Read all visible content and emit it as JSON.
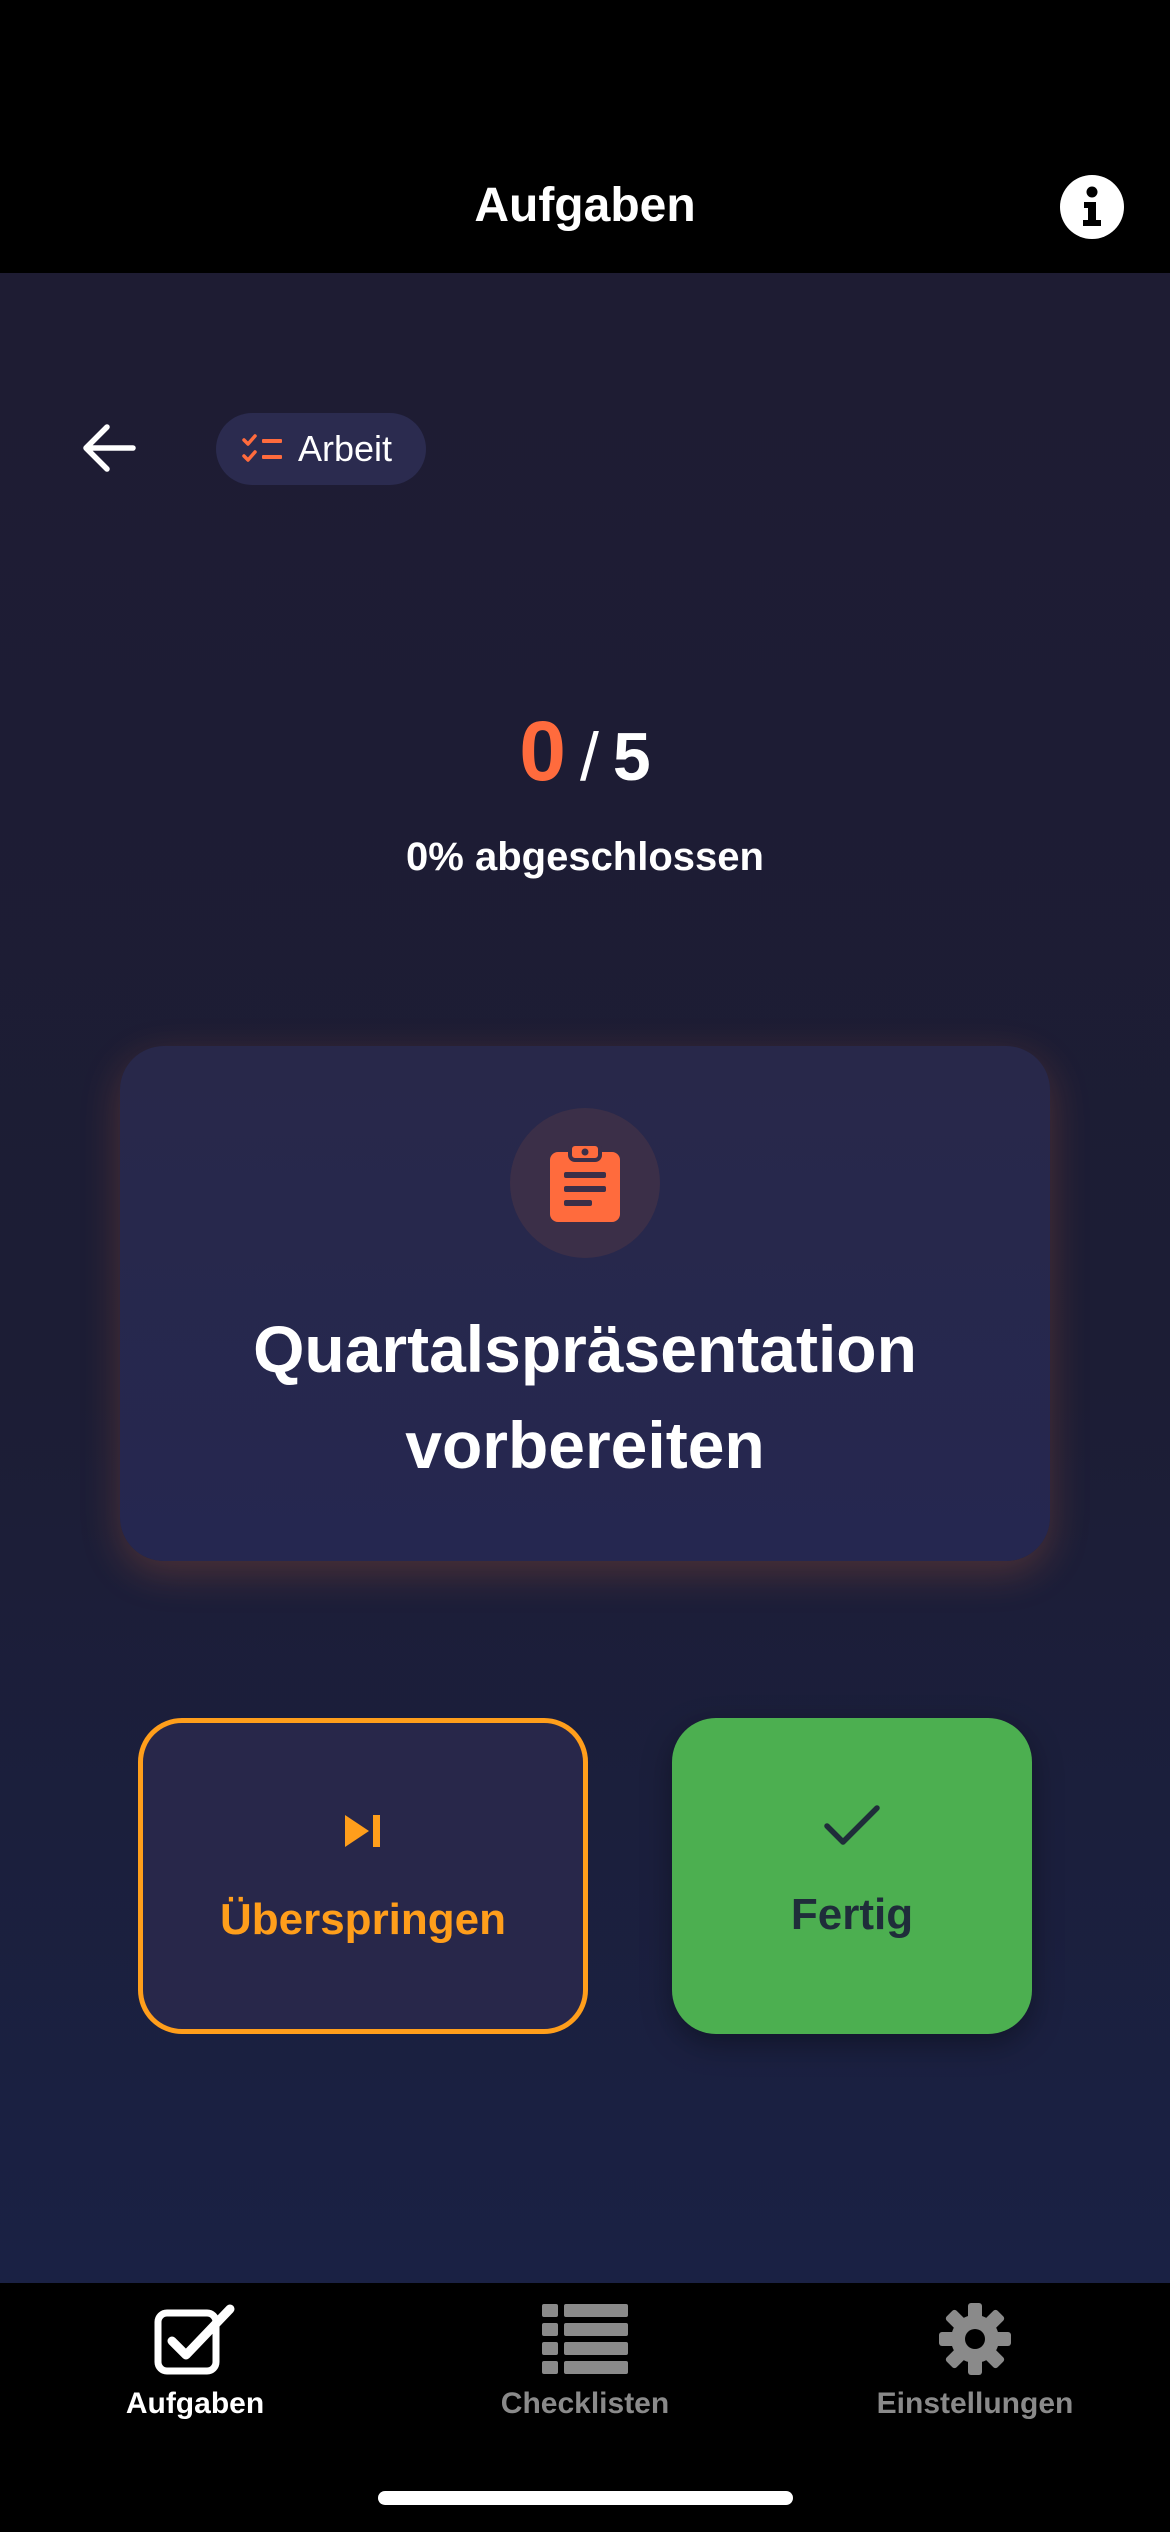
{
  "nav": {
    "title": "Aufgaben",
    "info_icon": "info-icon"
  },
  "category": {
    "label": "Arbeit",
    "icon": "checklist-icon",
    "icon_color": "#ff6b3d"
  },
  "progress": {
    "done": "0",
    "separator": "/",
    "total": "5",
    "percent_label": "0% abgeschlossen",
    "fraction_complete": 0
  },
  "task": {
    "title": "Quartalspräsentation vorbereiten",
    "icon": "clipboard-icon"
  },
  "actions": {
    "skip": {
      "label": "Überspringen",
      "icon": "skip-next-icon",
      "color": "#ff9e1b"
    },
    "done": {
      "label": "Fertig",
      "icon": "check-icon",
      "color": "#4caf50"
    }
  },
  "tabs": [
    {
      "label": "Aufgaben",
      "icon": "checkbox-icon",
      "active": true
    },
    {
      "label": "Checklisten",
      "icon": "list-icon",
      "active": false
    },
    {
      "label": "Einstellungen",
      "icon": "gear-icon",
      "active": false
    }
  ],
  "colors": {
    "accent": "#ff6b3d",
    "background": "#1e1c33",
    "card": "#28284a"
  }
}
